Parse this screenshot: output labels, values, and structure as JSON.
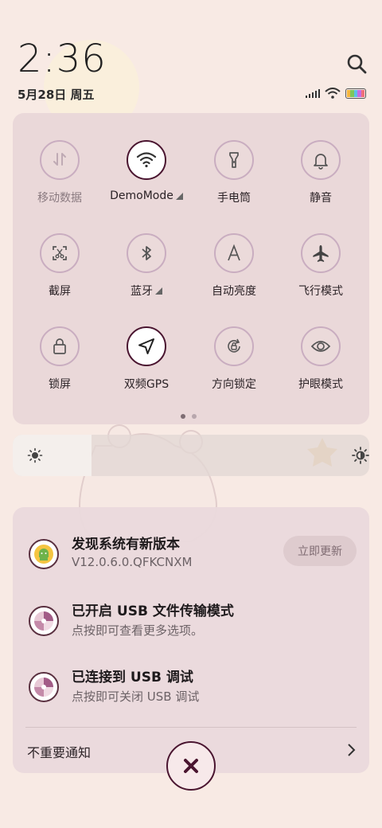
{
  "status": {
    "time": "2:36",
    "date": "5月28日 周五",
    "icons": [
      "signal-icon",
      "wifi-icon",
      "battery-icon"
    ],
    "battery_colors": [
      "#f4b63f",
      "#7fc65b",
      "#5cbfe8",
      "#c36fe3",
      "#f0707a"
    ]
  },
  "quick_settings": {
    "tiles": [
      {
        "label": "移动数据",
        "icon": "mobile-data-icon",
        "active": false,
        "dim": true
      },
      {
        "label": "DemoMode",
        "icon": "wifi-icon",
        "active": true,
        "has_arrow": true
      },
      {
        "label": "手电筒",
        "icon": "flashlight-icon",
        "active": false
      },
      {
        "label": "静音",
        "icon": "bell-icon",
        "active": false
      },
      {
        "label": "截屏",
        "icon": "screenshot-icon",
        "active": false
      },
      {
        "label": "蓝牙",
        "icon": "bluetooth-icon",
        "active": false,
        "has_arrow": true
      },
      {
        "label": "自动亮度",
        "icon": "auto-brightness-icon",
        "active": false
      },
      {
        "label": "飞行模式",
        "icon": "airplane-icon",
        "active": false
      },
      {
        "label": "锁屏",
        "icon": "lock-icon",
        "active": false
      },
      {
        "label": "双频GPS",
        "icon": "gps-arrow-icon",
        "active": true
      },
      {
        "label": "方向锁定",
        "icon": "rotation-lock-icon",
        "active": false
      },
      {
        "label": "护眼模式",
        "icon": "eye-icon",
        "active": false
      }
    ],
    "page_count": 2,
    "current_page": 1
  },
  "brightness": {
    "level": 0.22
  },
  "notifications": [
    {
      "title": "发现系统有新版本",
      "subtitle": "V12.0.6.0.QFKCNXM",
      "icon": "android-update-icon",
      "action": "立即更新"
    },
    {
      "title": "已开启 USB 文件传输模式",
      "subtitle": "点按即可查看更多选项。",
      "icon": "usb-icon"
    },
    {
      "title": "已连接到 USB 调试",
      "subtitle": "点按即可关闭 USB 调试",
      "icon": "usb-debug-icon"
    }
  ],
  "footer": {
    "unimportant_label": "不重要通知"
  },
  "colors": {
    "accent": "#4a1530",
    "panel": "#e8d6d8",
    "background": "#f8eae4"
  }
}
